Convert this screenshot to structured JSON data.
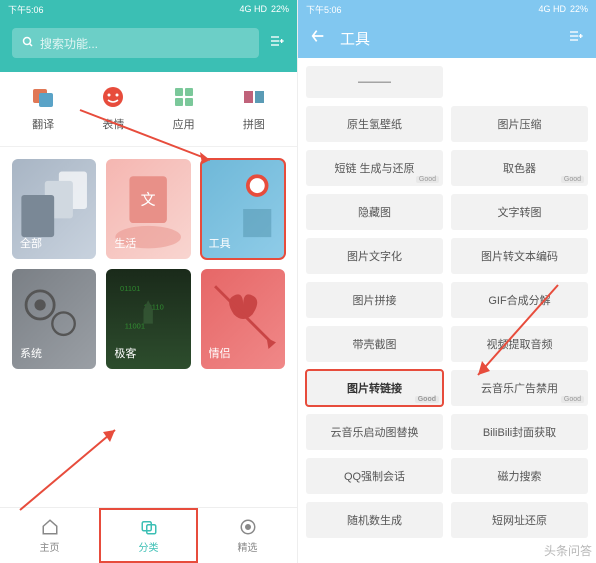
{
  "status": {
    "time": "下午5:06",
    "signal": "4G HD",
    "battery": "22%"
  },
  "left": {
    "search_placeholder": "搜索功能...",
    "categories": [
      {
        "label": "翻译"
      },
      {
        "label": "表情"
      },
      {
        "label": "应用"
      },
      {
        "label": "拼图"
      }
    ],
    "cards": [
      {
        "label": "全部",
        "bg": "#bfc8d4"
      },
      {
        "label": "生活",
        "bg": "#f5b6b1"
      },
      {
        "label": "工具",
        "bg": "#6fb8d8",
        "highlighted": true
      },
      {
        "label": "系统",
        "bg": "#7a7f85"
      },
      {
        "label": "极客",
        "bg": "#2d3436"
      },
      {
        "label": "情侣",
        "bg": "#e66767"
      }
    ],
    "nav": [
      {
        "label": "主页"
      },
      {
        "label": "分类",
        "active": true
      },
      {
        "label": "精选"
      }
    ]
  },
  "right": {
    "title": "工具",
    "tools": [
      [
        "———",
        ""
      ],
      [
        "原生氢壁纸",
        "图片压缩"
      ],
      [
        "短链 生成与还原",
        "取色器"
      ],
      [
        "隐藏图",
        "文字转图"
      ],
      [
        "图片文字化",
        "图片转文本编码"
      ],
      [
        "图片拼接",
        "GIF合成分解"
      ],
      [
        "带壳截图",
        "视频提取音频"
      ],
      [
        "图片转链接",
        "云音乐广告禁用"
      ],
      [
        "云音乐启动图替换",
        "BiliBili封面获取"
      ],
      [
        "QQ强制会话",
        "磁力搜索"
      ],
      [
        "随机数生成",
        "短网址还原"
      ]
    ],
    "good_rows": [
      2,
      7
    ],
    "highlight": "图片转链接"
  },
  "watermark": "头条问答"
}
